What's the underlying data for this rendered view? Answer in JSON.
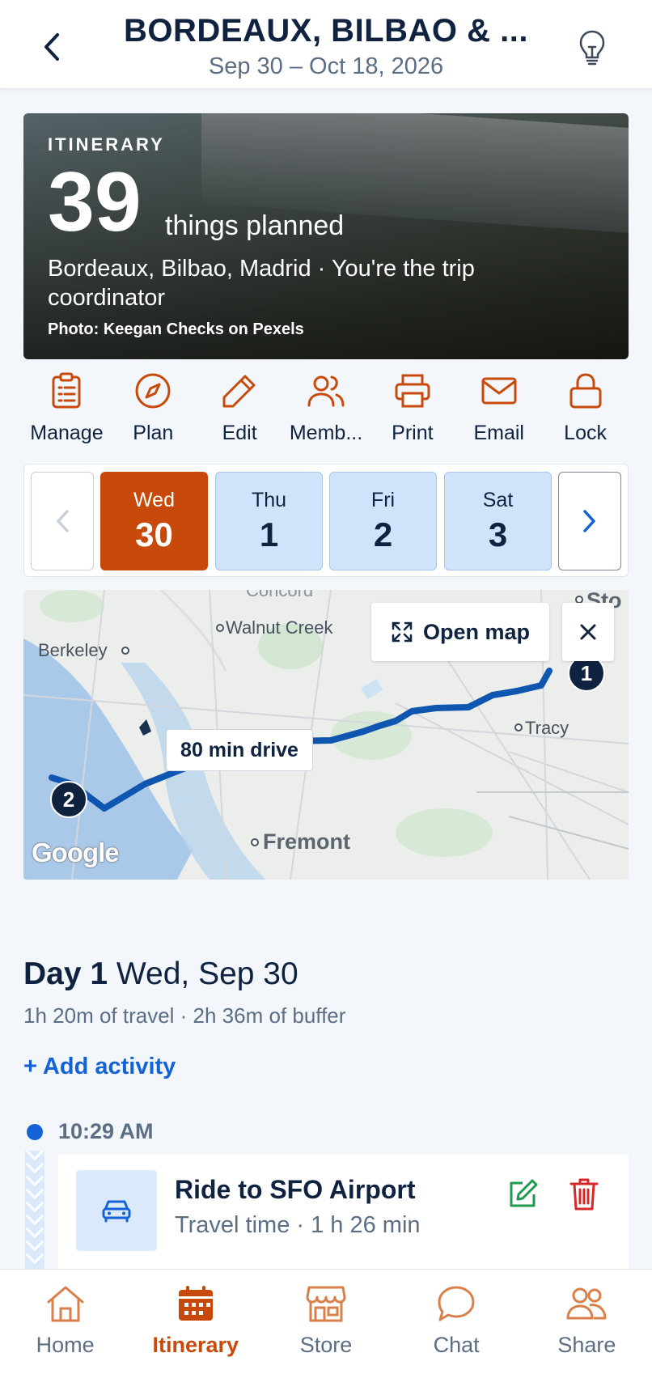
{
  "header": {
    "title": "BORDEAUX, BILBAO & ...",
    "dates": "Sep 30 – Oct 18, 2026"
  },
  "hero": {
    "eyebrow": "ITINERARY",
    "count": "39",
    "count_label": "things planned",
    "subtitle": "Bordeaux, Bilbao, Madrid · You're the trip coordinator",
    "photo_credit": "Photo: Keegan Checks on Pexels"
  },
  "actions": [
    {
      "label": "Manage",
      "icon": "clipboard-icon"
    },
    {
      "label": "Plan",
      "icon": "compass-icon"
    },
    {
      "label": "Edit",
      "icon": "pencil-icon"
    },
    {
      "label": "Memb...",
      "icon": "members-icon"
    },
    {
      "label": "Print",
      "icon": "printer-icon"
    },
    {
      "label": "Email",
      "icon": "envelope-icon"
    },
    {
      "label": "Lock",
      "icon": "lock-icon"
    }
  ],
  "days": [
    {
      "dow": "Wed",
      "num": "30",
      "selected": true
    },
    {
      "dow": "Thu",
      "num": "1",
      "selected": false
    },
    {
      "dow": "Fri",
      "num": "2",
      "selected": false
    },
    {
      "dow": "Sat",
      "num": "3",
      "selected": false
    }
  ],
  "map": {
    "open_map_label": "Open map",
    "drive_label": "80 min drive",
    "places": [
      "Walnut Creek",
      "Berkeley",
      "Tracy",
      "Fremont",
      "Concord",
      "Sto"
    ],
    "pins": [
      "1",
      "2"
    ],
    "attribution": "Google"
  },
  "day": {
    "title_bold": "Day 1",
    "title_rest": " Wed, Sep 30",
    "meta": "1h 20m of travel · 2h 36m of buffer",
    "add_activity": "+ Add activity"
  },
  "timeline": {
    "time": "10:29 AM",
    "card_title": "Ride to SFO Airport",
    "card_sub": "Travel time · 1 h 26 min"
  },
  "colors": {
    "accent": "#c84a0b",
    "link": "#1463d6",
    "navy": "#0f2340",
    "day_chip": "#cfe4fa"
  },
  "nav": [
    {
      "label": "Home",
      "icon": "home-icon",
      "active": false
    },
    {
      "label": "Itinerary",
      "icon": "calendar-icon",
      "active": true
    },
    {
      "label": "Store",
      "icon": "store-icon",
      "active": false
    },
    {
      "label": "Chat",
      "icon": "chat-icon",
      "active": false
    },
    {
      "label": "Share",
      "icon": "share-people-icon",
      "active": false
    }
  ]
}
